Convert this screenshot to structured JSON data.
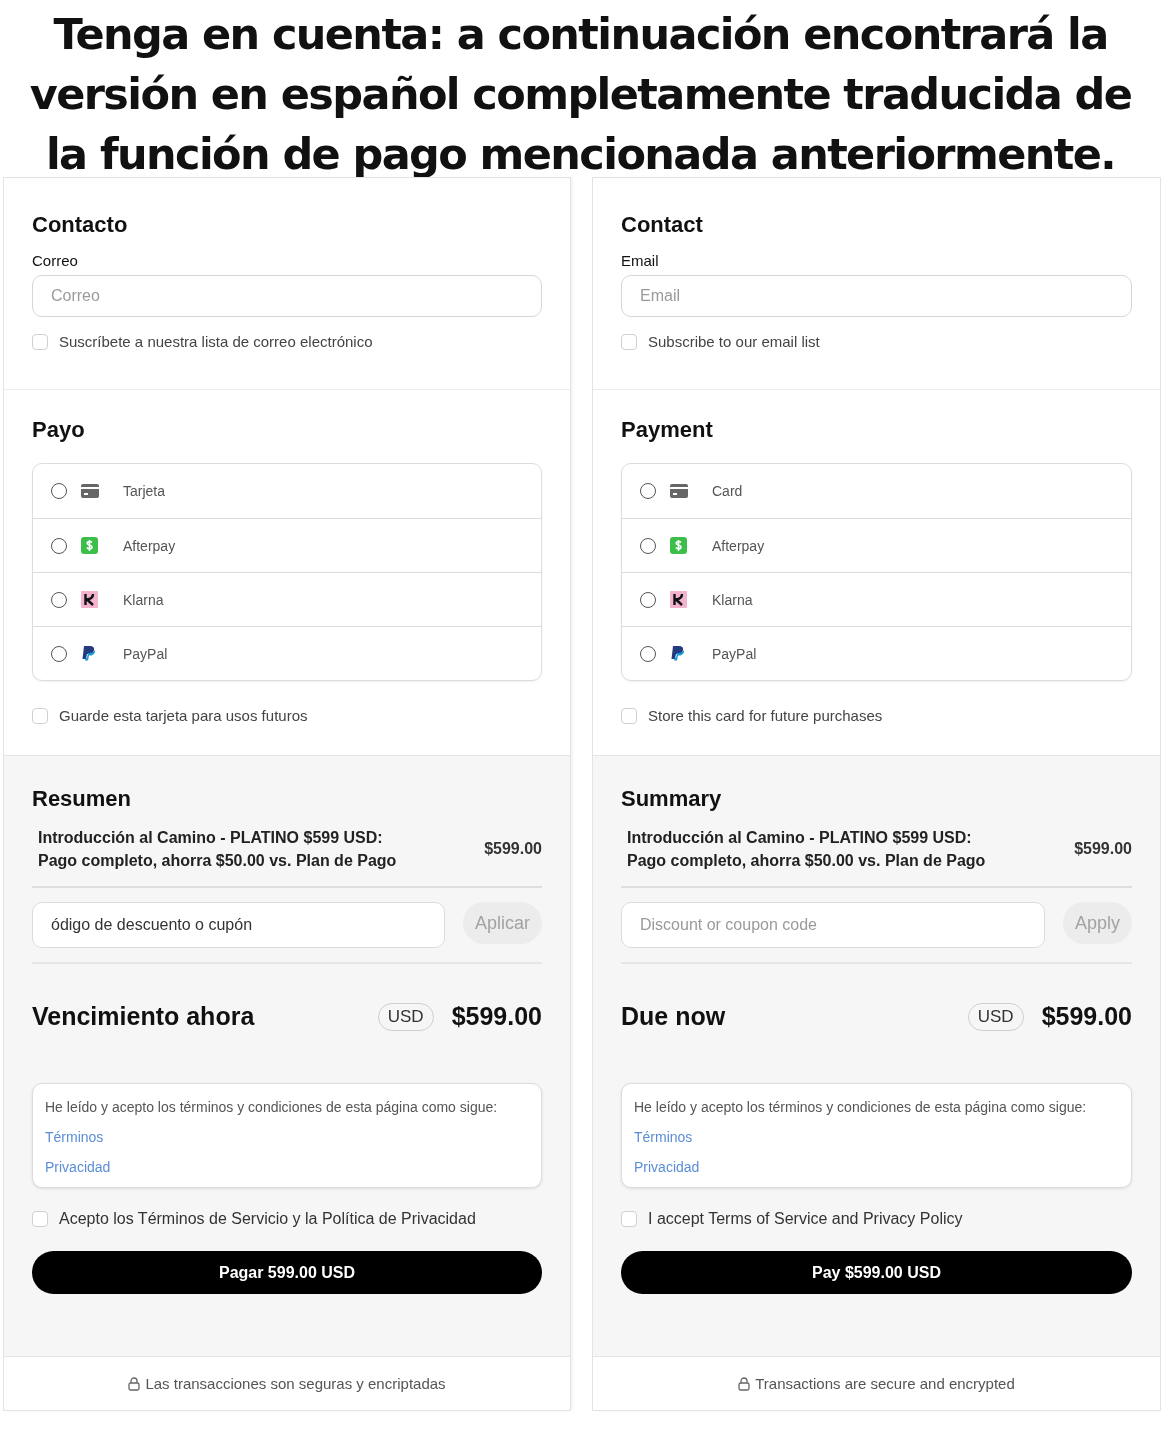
{
  "banner": "Tenga en cuenta: a continuación encontrará la versión en español completamente traducida de la función de pago mencionada anteriormente.",
  "panels": [
    {
      "contact": {
        "title": "Contacto",
        "email_label": "Correo",
        "email": {
          "placeholder": "Correo"
        },
        "subscribe": {
          "label": "Suscríbete a nuestra lista de correo electrónico",
          "checked": false
        }
      },
      "payment": {
        "title": "Payo",
        "methods": [
          {
            "kind": "card",
            "label": "Tarjeta",
            "selected": false
          },
          {
            "kind": "afterpay",
            "label": "Afterpay",
            "selected": false
          },
          {
            "kind": "klarna",
            "label": "Klarna",
            "selected": false
          },
          {
            "kind": "paypal",
            "label": "PayPal",
            "selected": false
          }
        ],
        "store_card": {
          "label": "Guarde esta tarjeta para usos futuros",
          "checked": false
        }
      },
      "summary": {
        "title": "Resumen",
        "item": {
          "name": "Introducción al Camino - PLATINO $599 USD: Pago completo, ahorra $50.00 vs. Plan de Pago",
          "price": "$599.00"
        },
        "discount": {
          "value": "ódigo de descuento o cupón"
        },
        "apply_button": "Aplicar",
        "due_label": "Vencimiento ahora",
        "currency": "USD",
        "due_amount": "$599.00",
        "terms": {
          "text": "He leído y acepto los términos y condiciones de esta página como sigue:",
          "links": [
            "Términos",
            "Privacidad"
          ]
        },
        "accept": {
          "label": "Acepto los Términos de Servicio y la Política de Privacidad",
          "checked": false
        },
        "pay_button": "Pagar 599.00 USD"
      },
      "footer": "Las transacciones son seguras y encriptadas"
    },
    {
      "contact": {
        "title": "Contact",
        "email_label": "Email",
        "email": {
          "placeholder": "Email"
        },
        "subscribe": {
          "label": "Subscribe to our email list",
          "checked": false
        }
      },
      "payment": {
        "title": "Payment",
        "methods": [
          {
            "kind": "card",
            "label": "Card",
            "selected": false
          },
          {
            "kind": "afterpay",
            "label": "Afterpay",
            "selected": false
          },
          {
            "kind": "klarna",
            "label": "Klarna",
            "selected": false
          },
          {
            "kind": "paypal",
            "label": "PayPal",
            "selected": false
          }
        ],
        "store_card": {
          "label": "Store this card for future purchases",
          "checked": false
        }
      },
      "summary": {
        "title": "Summary",
        "item": {
          "name": "Introducción al Camino - PLATINO $599 USD: Pago completo, ahorra $50.00 vs. Plan de Pago",
          "price": "$599.00"
        },
        "discount": {
          "placeholder": "Discount or coupon code"
        },
        "apply_button": "Apply",
        "due_label": "Due now",
        "currency": "USD",
        "due_amount": "$599.00",
        "terms": {
          "text": "He leído y acepto los términos y condiciones de esta página como sigue:",
          "links": [
            "Términos",
            "Privacidad"
          ]
        },
        "accept": {
          "label": "I accept Terms of Service and Privacy Policy",
          "checked": false
        },
        "pay_button": "Pay $599.00 USD"
      },
      "footer": "Transactions are secure and encrypted"
    }
  ]
}
